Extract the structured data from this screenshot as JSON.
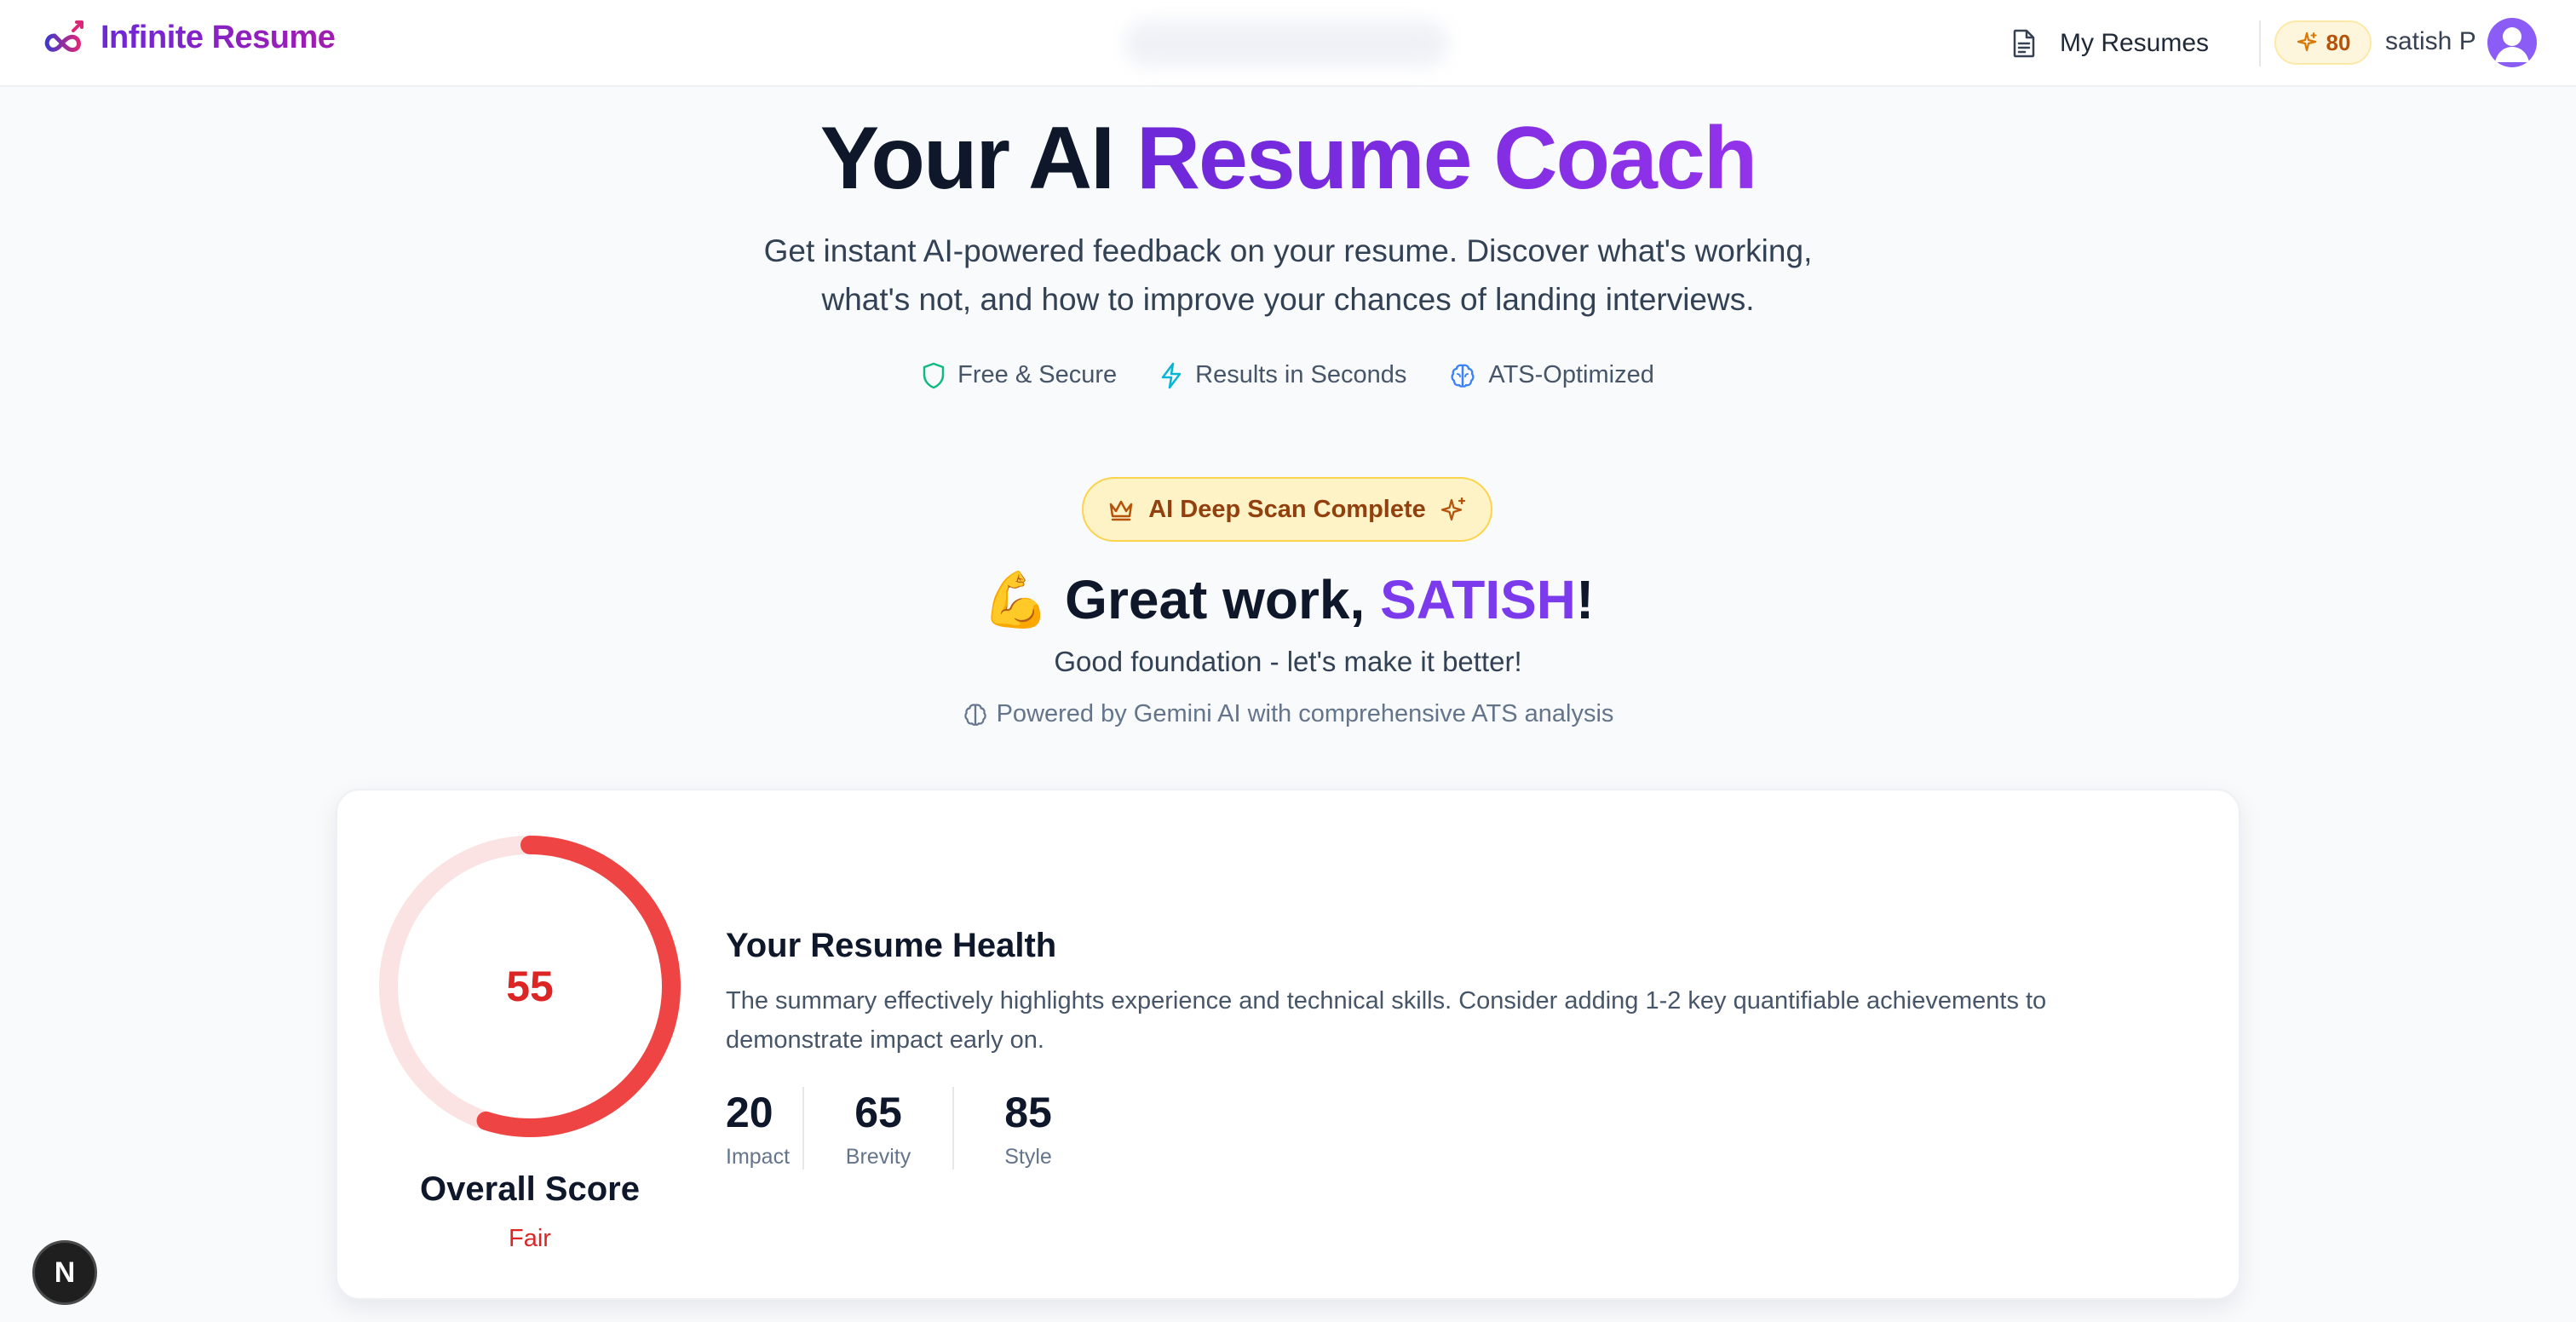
{
  "header": {
    "brand": "Infinite Resume",
    "nav_my_resumes": "My Resumes",
    "credits": "80",
    "username": "satish P"
  },
  "hero": {
    "title_part1": "Your AI ",
    "title_part2": "Resume Coach",
    "subtitle_line1": "Get instant AI-powered feedback on your resume. Discover what's working,",
    "subtitle_line2": "what's not, and how to improve your chances of landing interviews.",
    "features": [
      {
        "label": "Free & Secure",
        "icon": "shield-icon",
        "color": "#10b981"
      },
      {
        "label": "Results in Seconds",
        "icon": "lightning-icon",
        "color": "#06b6d4"
      },
      {
        "label": "ATS-Optimized",
        "icon": "brain-icon",
        "color": "#3b82f6"
      }
    ]
  },
  "results": {
    "badge": "AI Deep Scan Complete",
    "greeting_emoji": "💪",
    "greeting_prefix": "Great work, ",
    "greeting_name": "SATISH",
    "greeting_suffix": "!",
    "tagline": "Good foundation - let's make it better!",
    "powered_by": "Powered by Gemini AI with comprehensive ATS analysis"
  },
  "card": {
    "score": "55",
    "score_fraction": 0.55,
    "overall_label": "Overall Score",
    "overall_rating": "Fair",
    "health_title": "Your Resume Health",
    "health_desc": "The summary effectively highlights experience and technical skills. Consider adding 1-2 key quantifiable achievements to demonstrate impact early on.",
    "metrics": [
      {
        "value": "20",
        "label": "Impact"
      },
      {
        "value": "65",
        "label": "Brevity"
      },
      {
        "value": "85",
        "label": "Style"
      }
    ]
  },
  "colors": {
    "brand_purple": "#7c3aed",
    "score_red": "#dc2626",
    "gauge_track": "#fbe3e3"
  },
  "dev_indicator": "N"
}
